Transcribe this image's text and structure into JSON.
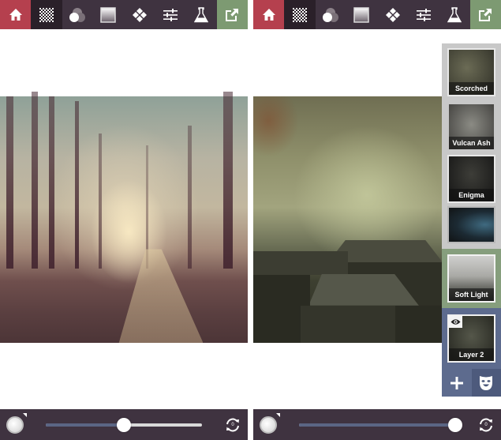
{
  "toolbar": {
    "items": [
      {
        "icon": "home-icon",
        "active_color": "#b5404e"
      },
      {
        "icon": "texture-checker-icon",
        "active_color": "#2a2029"
      },
      {
        "icon": "blend-circles-icon"
      },
      {
        "icon": "gradient-square-icon"
      },
      {
        "icon": "diamond-grid-icon"
      },
      {
        "icon": "sliders-icon"
      },
      {
        "icon": "flask-icon"
      },
      {
        "icon": "export-icon",
        "active_color": "#7d9a72"
      }
    ]
  },
  "left_screen": {
    "photo": "foggy forest path",
    "opacity_slider": {
      "value": 0.5
    },
    "reset_count": "0"
  },
  "right_screen": {
    "photo": "textured overcast town rooftops",
    "layer_panel": {
      "textures": [
        {
          "label": "Scorched"
        },
        {
          "label": "Vulcan Ash"
        },
        {
          "label": "Enigma"
        },
        {
          "label": ""
        }
      ],
      "blend_mode": {
        "label": "Soft Light"
      },
      "layer": {
        "label": "Layer 2",
        "visible": true
      },
      "actions": {
        "add": "+",
        "mask": "mask-icon"
      }
    },
    "opacity_slider": {
      "value": 1.0
    },
    "reset_count": "0"
  },
  "colors": {
    "toolbar_bg": "#3f3340",
    "home_red": "#b5404e",
    "export_green": "#7d9a72",
    "panel_gray": "#c8c8c8",
    "panel_green": "#869e7d",
    "panel_blue": "#5d6b8e",
    "slider_fill": "#5b6584"
  }
}
